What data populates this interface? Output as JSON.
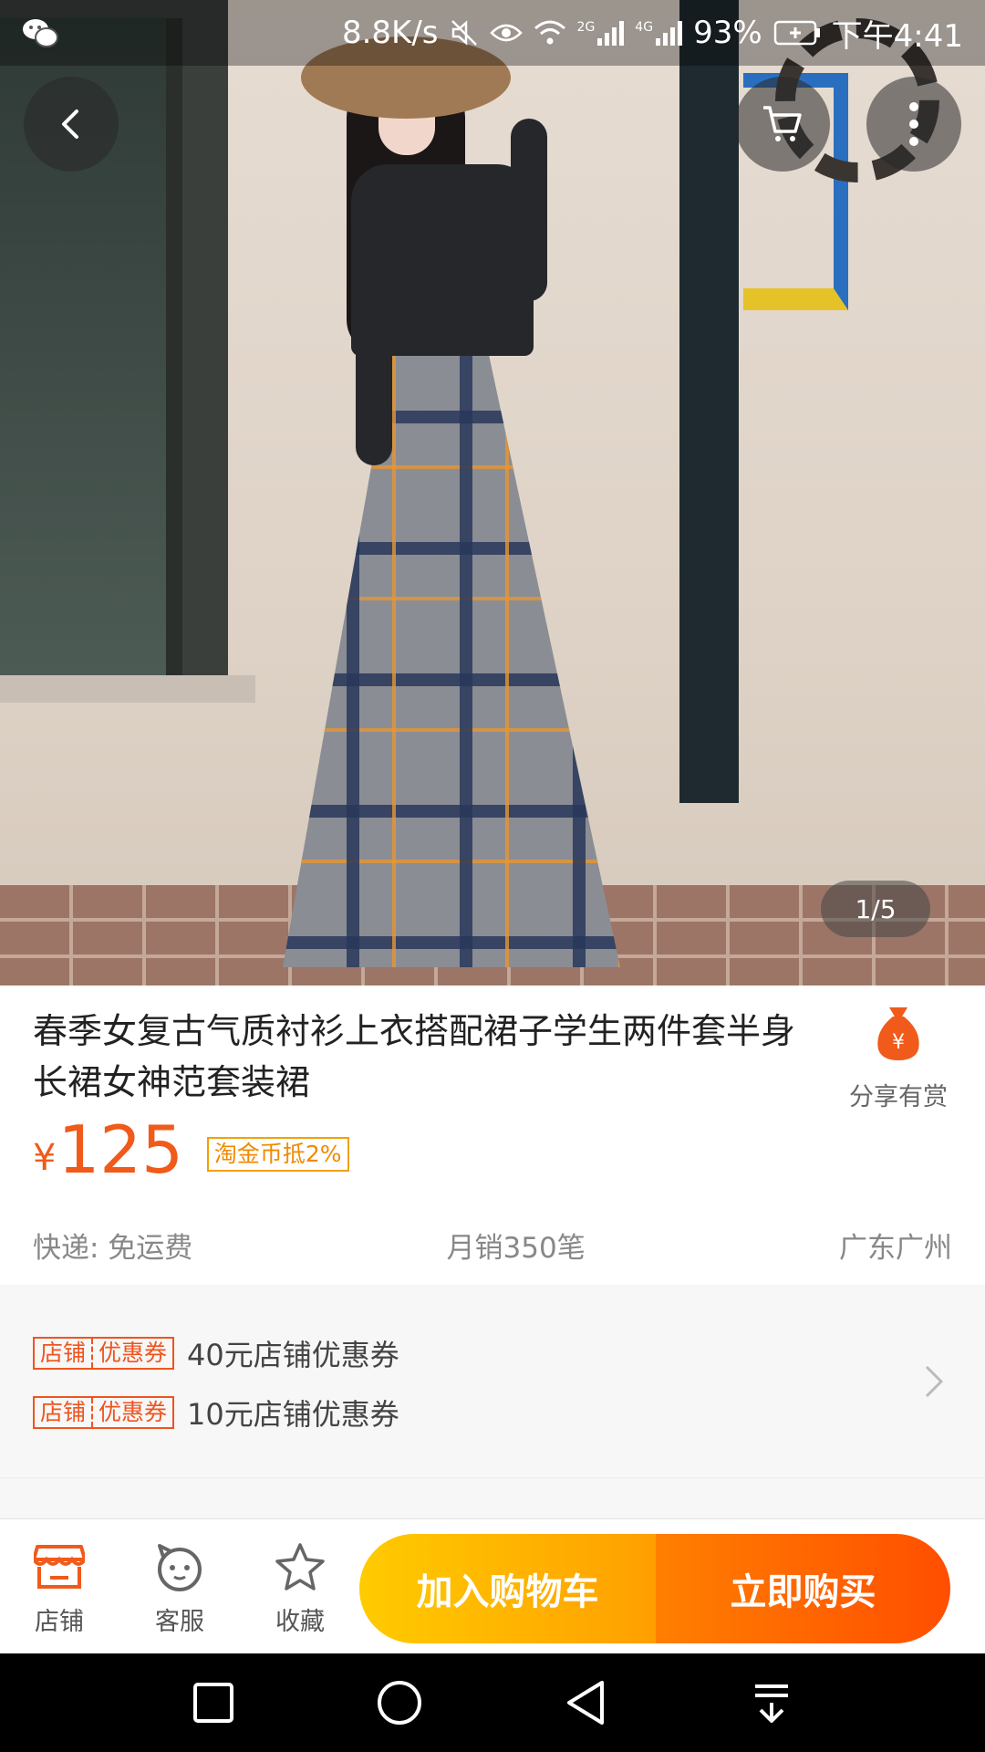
{
  "status_bar": {
    "app_icon": "wechat-icon",
    "net_speed": "8.8K/s",
    "sig_2g": "2G",
    "sig_4g": "4G",
    "battery": "93%",
    "time": "下午4:41",
    "icons": [
      "mute-icon",
      "eye-icon",
      "wifi-icon",
      "signal-icon",
      "signal-icon",
      "battery-charging-icon"
    ]
  },
  "hero": {
    "pager": "1/5",
    "back_icon": "back-arrow-icon",
    "cart_icon": "cart-icon",
    "more_icon": "more-vertical-icon"
  },
  "product": {
    "title": "春季女复古气质衬衫上衣搭配裙子学生两件套半身长裙女神范套装裙",
    "share_label": "分享有赏",
    "currency": "¥",
    "price": "125",
    "coin_tag": "淘金币抵2%",
    "shipping": "快递: 免运费",
    "monthly_sales": "月销350笔",
    "location": "广东广州"
  },
  "coupons": [
    {
      "tag_a": "店铺",
      "tag_b": "优惠券",
      "text": "40元店铺优惠券"
    },
    {
      "tag_a": "店铺",
      "tag_b": "优惠券",
      "text": "10元店铺优惠券"
    }
  ],
  "action_bar": {
    "store_label": "店铺",
    "service_label": "客服",
    "favorite_label": "收藏",
    "add_to_cart": "加入购物车",
    "buy_now": "立即购买"
  },
  "colors": {
    "accent": "#f05a1a",
    "cart_button": "#ffb300",
    "buy_button": "#ff5a00"
  }
}
